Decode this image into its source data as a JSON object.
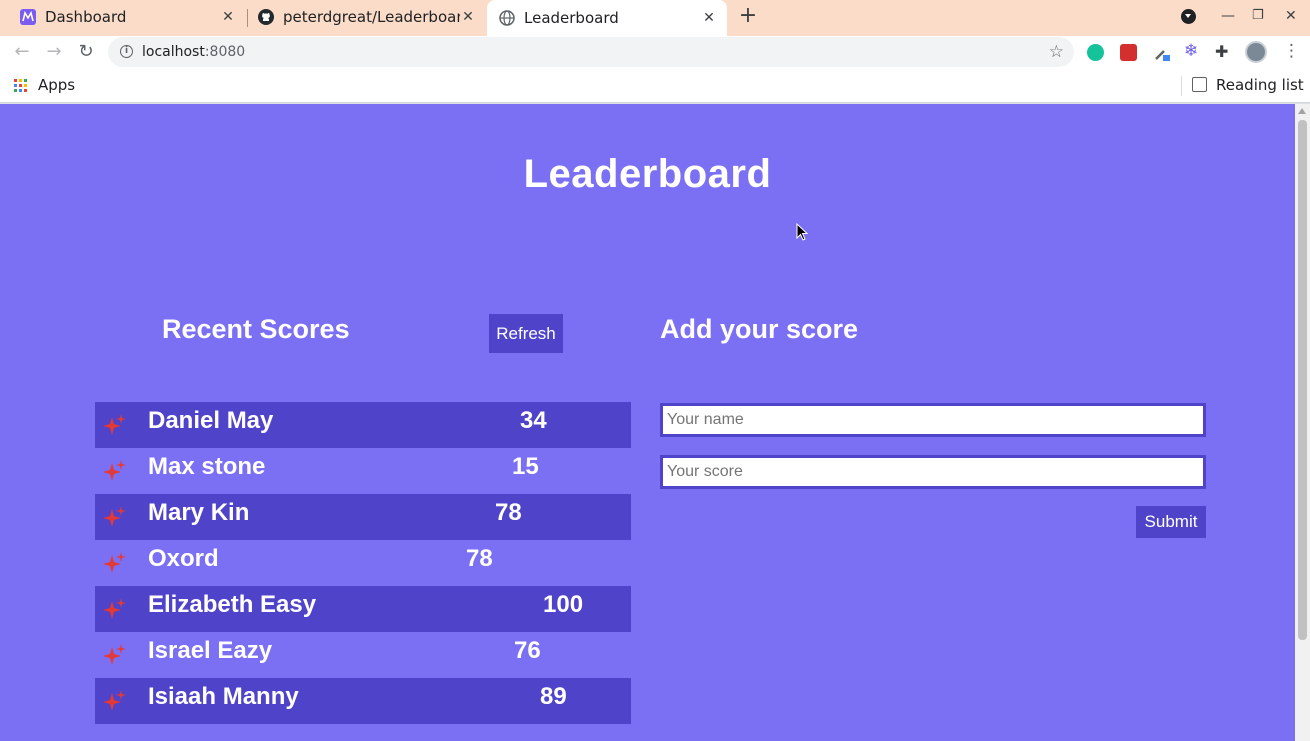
{
  "browser": {
    "tabs": [
      {
        "title": "Dashboard",
        "icon": "dashboard-favicon"
      },
      {
        "title": "peterdgreat/Leaderboard",
        "icon": "github-favicon"
      },
      {
        "title": "Leaderboard",
        "icon": "globe-favicon"
      }
    ],
    "active_tab": 2,
    "url_host": "localhost",
    "url_port": ":8080",
    "bookmarks": {
      "apps_label": "Apps",
      "reading_list_label": "Reading list"
    }
  },
  "page": {
    "title": "Leaderboard",
    "recent_scores_title": "Recent Scores",
    "refresh_label": "Refresh",
    "add_score_title": "Add your score",
    "name_placeholder": "Your name",
    "score_placeholder": "Your score",
    "submit_label": "Submit",
    "scores": [
      {
        "name": "Daniel May",
        "score": "34"
      },
      {
        "name": "Max stone",
        "score": "15"
      },
      {
        "name": "Mary Kin",
        "score": "78"
      },
      {
        "name": "Oxord",
        "score": "78"
      },
      {
        "name": "Elizabeth Easy",
        "score": "100"
      },
      {
        "name": "Israel Eazy",
        "score": "76"
      },
      {
        "name": "Isiaah Manny",
        "score": "89"
      }
    ]
  },
  "colors": {
    "page_background": "#7b70f3",
    "accent": "#4f43c9",
    "sparkle": "#e53935"
  }
}
